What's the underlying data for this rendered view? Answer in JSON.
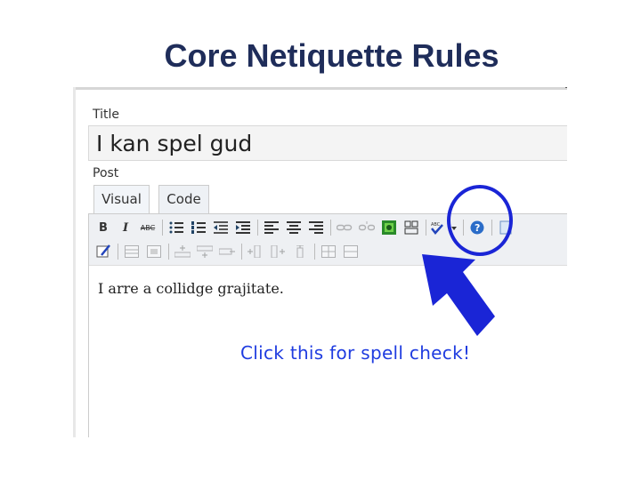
{
  "slide": {
    "title": "Core Netiquette Rules"
  },
  "editor": {
    "title_label": "Title",
    "title_value": "I kan spel gud",
    "post_label": "Post",
    "tabs": [
      {
        "label": "Visual"
      },
      {
        "label": "Code"
      }
    ],
    "toolbar": {
      "bold": "B",
      "italic": "I",
      "strikethrough": "ABC"
    },
    "content": "I arre a collidge grajitate."
  },
  "annotation": {
    "callout": "Click this for spell check!",
    "highlight_color": "#1a25d6",
    "text_color": "#1f3ce0"
  },
  "icons": [
    "bold-icon",
    "italic-icon",
    "strikethrough-icon",
    "bullet-list-icon",
    "numbered-list-icon",
    "outdent-icon",
    "indent-icon",
    "align-left-icon",
    "align-center-icon",
    "align-right-icon",
    "link-icon",
    "unlink-icon",
    "insert-image-icon",
    "more-tag-icon",
    "spellcheck-icon",
    "help-icon",
    "kitchen-sink-icon"
  ]
}
